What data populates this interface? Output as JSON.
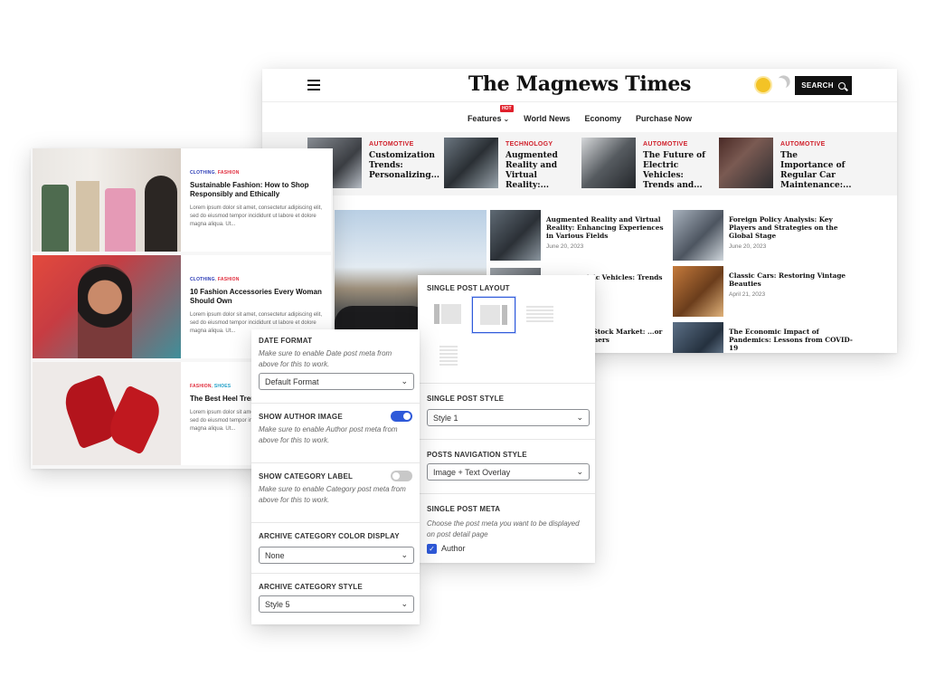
{
  "site": {
    "logo": "The Magnews Times",
    "search_label": "SEARCH",
    "nav": [
      {
        "label": "Features",
        "badge": "HOT"
      },
      {
        "label": "World News"
      },
      {
        "label": "Economy"
      },
      {
        "label": "Purchase Now"
      }
    ],
    "trending": [
      {
        "category": "AUTOMOTIVE",
        "title": "Customization Trends: Personalizing..."
      },
      {
        "category": "TECHNOLOGY",
        "title": "Augmented Reality and Virtual Reality:..."
      },
      {
        "category": "AUTOMOTIVE",
        "title": "The Future of Electric Vehicles: Trends and..."
      },
      {
        "category": "AUTOMOTIVE",
        "title": "The Importance of Regular Car Maintenance:..."
      }
    ],
    "posts": [
      {
        "title": "Augmented Reality and Virtual Reality: Enhancing Experiences in Various Fields",
        "date": "June 20, 2023"
      },
      {
        "title": "Foreign Policy Analysis: Key Players and Strategies on the Global Stage",
        "date": "June 20, 2023"
      },
      {
        "title": "...ectric Vehicles: Trends ...s",
        "date": ""
      },
      {
        "title": "Classic Cars: Restoring Vintage Beauties",
        "date": "April 21, 2023"
      },
      {
        "title": "...the Stock Market: ...or Beginners",
        "date": ""
      },
      {
        "title": "The Economic Impact of Pandemics: Lessons from COVID-19",
        "date": ""
      }
    ]
  },
  "blog": {
    "posts": [
      {
        "cat1": "CLOTHING",
        "cat2": "FASHION",
        "title": "Sustainable Fashion: How to Shop Responsibly and Ethically",
        "excerpt": "Lorem ipsum dolor sit amet, consectetur adipiscing elit, sed do eiusmod tempor incididunt ut labore et dolore magna aliqua. Ut..."
      },
      {
        "cat1": "CLOTHING",
        "cat2": "FASHION",
        "title": "10 Fashion Accessories Every Woman Should Own",
        "excerpt": "Lorem ipsum dolor sit amet, consectetur adipiscing elit, sed do eiusmod tempor incididunt ut labore et dolore magna aliqua. Ut..."
      },
      {
        "cat1": "FASHION",
        "cat2": "SHOES",
        "title": "The Best Heel Trends ... Season",
        "excerpt": "Lorem ipsum dolor sit amet, consectetur adipiscing elit, sed do eiusmod tempor incididunt ut labore et dolore magna aliqua. Ut..."
      }
    ]
  },
  "settings_left": {
    "date_format": {
      "label": "DATE FORMAT",
      "desc": "Make sure to enable Date post meta from above for this to work.",
      "value": "Default Format"
    },
    "show_author_image": {
      "label": "SHOW AUTHOR IMAGE",
      "desc": "Make sure to enable Author post meta from above for this to work.",
      "enabled": true
    },
    "show_category_label": {
      "label": "SHOW CATEGORY LABEL",
      "desc": "Make sure to enable Category post meta from above for this to work.",
      "enabled": false
    },
    "archive_color": {
      "label": "ARCHIVE CATEGORY COLOR DISPLAY",
      "value": "None"
    },
    "archive_style": {
      "label": "ARCHIVE CATEGORY STYLE",
      "value": "Style 5"
    }
  },
  "settings_right": {
    "layout": {
      "label": "SINGLE POST LAYOUT",
      "selected_option": 2
    },
    "style": {
      "label": "SINGLE POST STYLE",
      "value": "Style 1"
    },
    "nav_style": {
      "label": "POSTS NAVIGATION STYLE",
      "value": "Image + Text Overlay"
    },
    "meta": {
      "label": "SINGLE POST META",
      "desc": "Choose the post meta you want to be displayed on post detail page",
      "author_label": "Author",
      "author_checked": true
    }
  },
  "colors": {
    "accent_red": "#d0202b",
    "toggle_on": "#2e59d9",
    "toggle_off": "#c8c8c8",
    "category_blue": "#2b3bb6",
    "category_red": "#e02a3a"
  }
}
